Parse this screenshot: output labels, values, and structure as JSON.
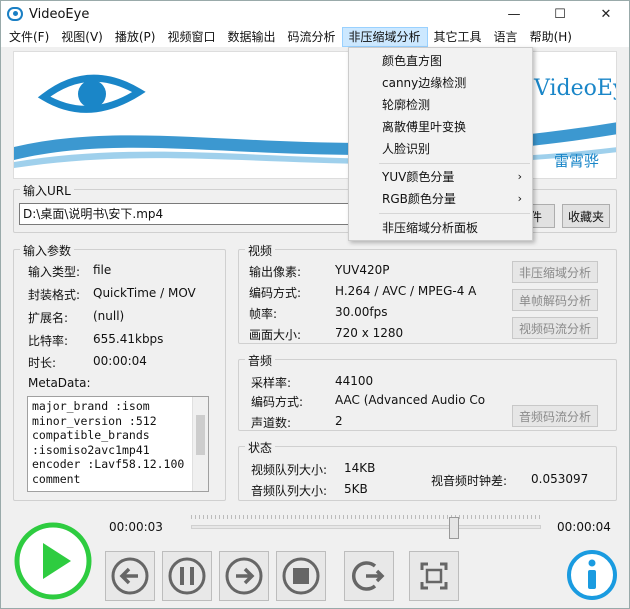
{
  "window": {
    "title": "VideoEye",
    "minimize": "—",
    "maximize": "☐",
    "close": "✕"
  },
  "menu": [
    "文件(F)",
    "视图(V)",
    "播放(P)",
    "视频窗口",
    "数据输出",
    "码流分析",
    "非压缩域分析",
    "其它工具",
    "语言",
    "帮助(H)"
  ],
  "banner": {
    "brand": "VideoEye",
    "author": "雷霄骅"
  },
  "url": {
    "label": "输入URL",
    "value": "D:\\桌面\\说明书\\安下.mp4",
    "open_button": "件",
    "favorites_button": "收藏夹"
  },
  "input_params": {
    "title": "输入参数",
    "rows": [
      {
        "key": "输入类型:",
        "value": "file"
      },
      {
        "key": "封装格式:",
        "value": "QuickTime / MOV"
      },
      {
        "key": "扩展名:",
        "value": "(null)"
      },
      {
        "key": "比特率:",
        "value": "655.41kbps"
      },
      {
        "key": "时长:",
        "value": "00:00:04"
      }
    ],
    "metadata_label": "MetaData:",
    "metadata": [
      "major_brand    :isom",
      "minor_version  :512",
      "compatible_brands",
      ":isomiso2avc1mp41",
      "encoder :Lavf58.12.100",
      "comment"
    ]
  },
  "video": {
    "title": "视频",
    "rows": [
      {
        "key": "输出像素:",
        "value": "YUV420P"
      },
      {
        "key": "编码方式:",
        "value": "H.264 / AVC / MPEG-4 A"
      },
      {
        "key": "帧率:",
        "value": "30.00fps"
      },
      {
        "key": "画面大小:",
        "value": "720 x 1280"
      }
    ],
    "buttons": [
      "非压缩域分析",
      "单帧解码分析",
      "视频码流分析"
    ]
  },
  "audio": {
    "title": "音频",
    "rows": [
      {
        "key": "采样率:",
        "value": "44100"
      },
      {
        "key": "编码方式:",
        "value": "AAC (Advanced Audio Co"
      },
      {
        "key": "声道数:",
        "value": "2"
      }
    ],
    "button": "音频码流分析"
  },
  "status": {
    "title": "状态",
    "video_queue_label": "视频队列大小:",
    "video_queue_value": "14KB",
    "audio_queue_label": "音频队列大小:",
    "audio_queue_value": "5KB",
    "av_diff_label": "视音频时钟差:",
    "av_diff_value": "0.053097"
  },
  "playback": {
    "current": "00:00:03",
    "total": "00:00:04",
    "progress": 0.75
  },
  "dropdown": {
    "items": [
      "颜色直方图",
      "canny边缘检测",
      "轮廓检测",
      "离散傅里叶变换",
      "人脸识别"
    ],
    "submenus": [
      "YUV颜色分量",
      "RGB颜色分量"
    ],
    "last": "非压缩域分析面板"
  },
  "colors": {
    "accent": "#1a86c8",
    "play": "#2ecc40",
    "info": "#1a9be0"
  }
}
